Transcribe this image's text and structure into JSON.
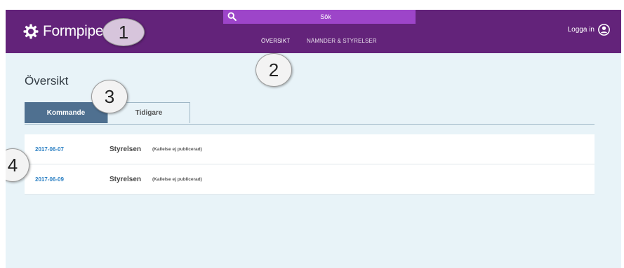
{
  "header": {
    "logo_text": "Formpipe.",
    "search": {
      "placeholder": "Sök"
    },
    "nav": [
      {
        "label": "ÖVERSIKT",
        "active": true
      },
      {
        "label": "NÄMNDER & STYRELSER",
        "active": false
      }
    ],
    "login_label": "Logga in"
  },
  "callouts": [
    "1",
    "2",
    "3",
    "4"
  ],
  "main": {
    "title": "Översikt",
    "tabs": [
      {
        "label": "Kommande",
        "active": true
      },
      {
        "label": "Tidigare",
        "active": false
      }
    ],
    "meetings": [
      {
        "date": "2017-06-07",
        "board": "Styrelsen",
        "status": "(Kallelse ej publicerad)"
      },
      {
        "date": "2017-06-09",
        "board": "Styrelsen",
        "status": "(Kallelse ej publicerad)"
      }
    ]
  },
  "colors": {
    "header_bg": "#63237a",
    "search_bg": "#9d45c9",
    "page_bg": "#e8f3f8",
    "tab_active_bg": "#4f7090",
    "link": "#2a7fc3"
  }
}
